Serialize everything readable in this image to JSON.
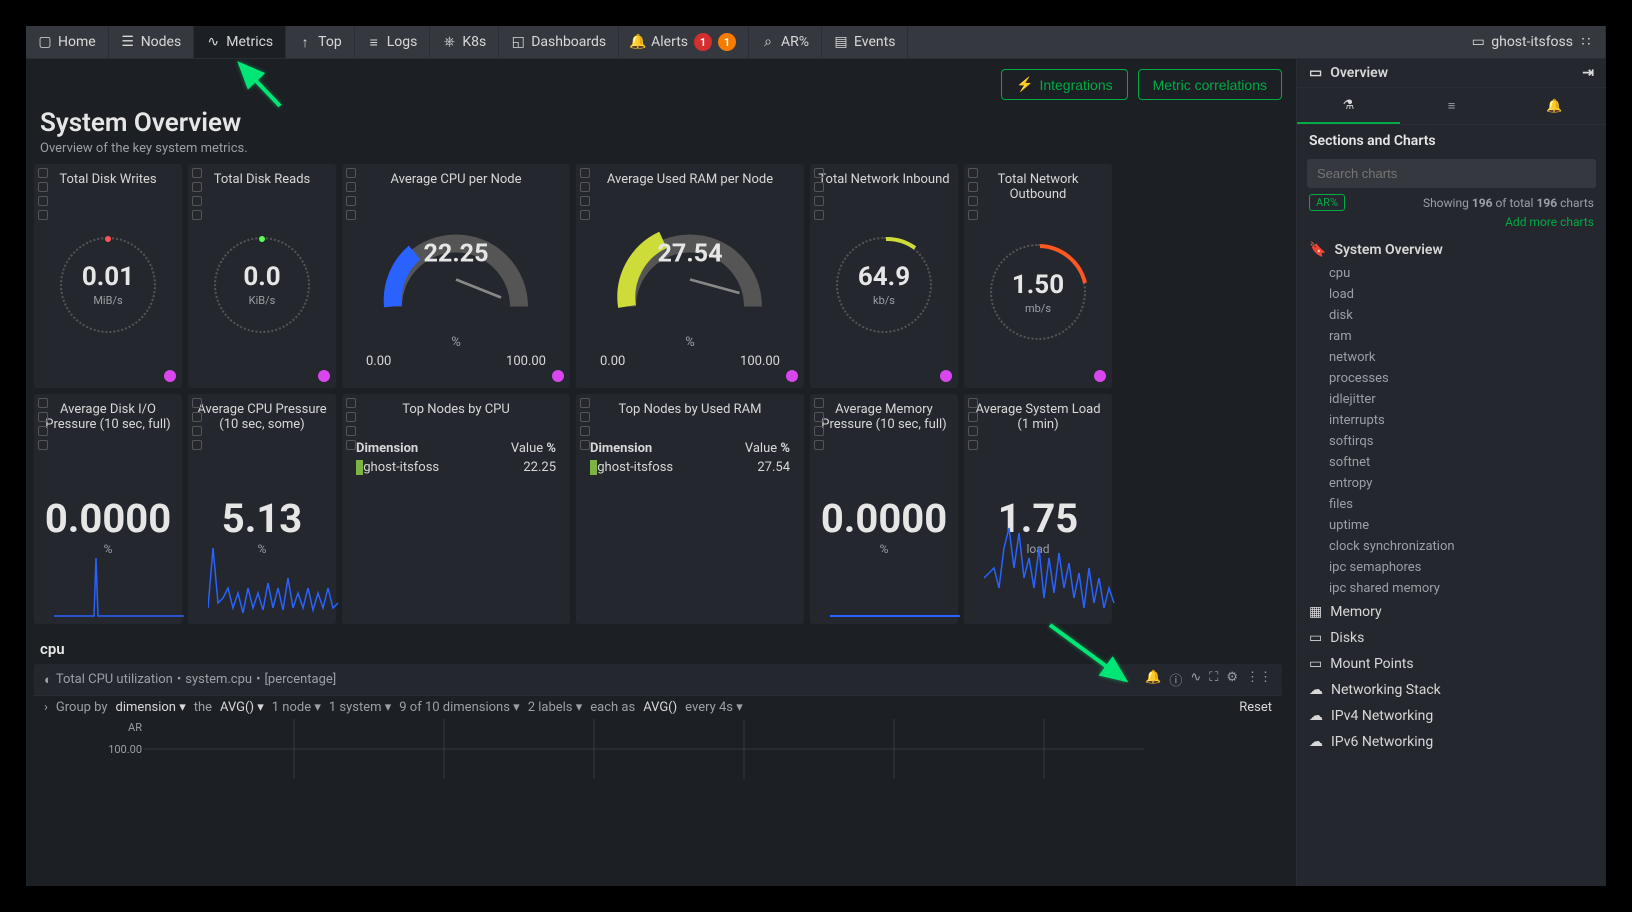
{
  "tabs": {
    "home": "Home",
    "nodes": "Nodes",
    "metrics": "Metrics",
    "top": "Top",
    "logs": "Logs",
    "k8s": "K8s",
    "dashboards": "Dashboards",
    "alerts": "Alerts",
    "alerts_badge_red": "1",
    "alerts_badge_orange": "1",
    "ar": "AR%",
    "events": "Events",
    "node_name": "ghost-itsfoss"
  },
  "actions": {
    "integrations": "Integrations",
    "correlations": "Metric correlations"
  },
  "page": {
    "title": "System Overview",
    "subtitle": "Overview of the key system metrics."
  },
  "cards": {
    "disk_writes": {
      "title": "Total Disk Writes",
      "value": "0.01",
      "unit": "MiB/s"
    },
    "disk_reads": {
      "title": "Total Disk Reads",
      "value": "0.0",
      "unit": "KiB/s"
    },
    "cpu_gauge": {
      "title": "Average CPU per Node",
      "value": "22.25",
      "unit": "%",
      "min": "0.00",
      "max": "100.00"
    },
    "ram_gauge": {
      "title": "Average Used RAM per Node",
      "value": "27.54",
      "unit": "%",
      "min": "0.00",
      "max": "100.00"
    },
    "net_in": {
      "title": "Total Network Inbound",
      "value": "64.9",
      "unit": "kb/s"
    },
    "net_out": {
      "title": "Total Network Outbound",
      "value": "1.50",
      "unit": "mb/s"
    },
    "disk_io_pressure": {
      "title": "Average Disk I/O Pressure (10 sec, full)",
      "value": "0.0000",
      "unit": "%"
    },
    "cpu_pressure": {
      "title": "Average CPU Pressure (10 sec, some)",
      "value": "5.13",
      "unit": "%"
    },
    "top_cpu": {
      "title": "Top Nodes by CPU",
      "dim_h": "Dimension",
      "val_h": "Value %",
      "row_name": "ghost-itsfoss",
      "row_val": "22.25"
    },
    "top_ram": {
      "title": "Top Nodes by Used RAM",
      "dim_h": "Dimension",
      "val_h": "Value %",
      "row_name": "ghost-itsfoss",
      "row_val": "27.54"
    },
    "mem_pressure": {
      "title": "Average Memory Pressure (10 sec, full)",
      "value": "0.0000",
      "unit": "%"
    },
    "sys_load": {
      "title": "Average System Load (1 min)",
      "value": "1.75",
      "unit": "load"
    }
  },
  "cpu_section": {
    "heading": "cpu",
    "crumb1": "Total CPU utilization",
    "crumb2": "system.cpu",
    "crumb3": "[percentage]",
    "groupby": "Group by",
    "dimension": "dimension",
    "the": "the",
    "avg": "AVG()",
    "node": "1 node",
    "system": "1 system",
    "dims": "9 of 10 dimensions",
    "labels": "2 labels",
    "eachas": "each as",
    "every": "every 4s",
    "reset": "Reset",
    "ylab1": "AR",
    "ylab2": "100.00"
  },
  "sidebar": {
    "overview": "Overview",
    "sections_title": "Sections and Charts",
    "search_placeholder": "Search charts",
    "pill": "AR%",
    "showing_pre": "Showing",
    "showing_n1": "196",
    "showing_mid": "of total",
    "showing_n2": "196",
    "showing_suf": "charts",
    "add_more": "Add more charts",
    "group_system": "System Overview",
    "items": [
      "cpu",
      "load",
      "disk",
      "ram",
      "network",
      "processes",
      "idlejitter",
      "interrupts",
      "softirqs",
      "softnet",
      "entropy",
      "files",
      "uptime",
      "clock synchronization",
      "ipc semaphores",
      "ipc shared memory"
    ],
    "group_memory": "Memory",
    "group_disks": "Disks",
    "group_mount": "Mount Points",
    "group_netstack": "Networking Stack",
    "group_ipv4": "IPv4 Networking",
    "group_ipv6": "IPv6 Networking"
  },
  "chart_data": [
    {
      "type": "gauge",
      "title": "Total Disk Writes",
      "value": 0.01,
      "unit": "MiB/s"
    },
    {
      "type": "gauge",
      "title": "Total Disk Reads",
      "value": 0.0,
      "unit": "KiB/s"
    },
    {
      "type": "gauge",
      "title": "Average CPU per Node",
      "value": 22.25,
      "min": 0,
      "max": 100,
      "unit": "%"
    },
    {
      "type": "gauge",
      "title": "Average Used RAM per Node",
      "value": 27.54,
      "min": 0,
      "max": 100,
      "unit": "%"
    },
    {
      "type": "gauge",
      "title": "Total Network Inbound",
      "value": 64.9,
      "unit": "kb/s"
    },
    {
      "type": "gauge",
      "title": "Total Network Outbound",
      "value": 1.5,
      "unit": "mb/s"
    },
    {
      "type": "line",
      "title": "Average Disk I/O Pressure (10 sec, full)",
      "latest": 0.0,
      "unit": "%"
    },
    {
      "type": "line",
      "title": "Average CPU Pressure (10 sec, some)",
      "latest": 5.13,
      "unit": "%"
    },
    {
      "type": "table",
      "title": "Top Nodes by CPU",
      "columns": [
        "Dimension",
        "Value %"
      ],
      "rows": [
        [
          "ghost-itsfoss",
          22.25
        ]
      ]
    },
    {
      "type": "table",
      "title": "Top Nodes by Used RAM",
      "columns": [
        "Dimension",
        "Value %"
      ],
      "rows": [
        [
          "ghost-itsfoss",
          27.54
        ]
      ]
    },
    {
      "type": "line",
      "title": "Average Memory Pressure (10 sec, full)",
      "latest": 0.0,
      "unit": "%"
    },
    {
      "type": "line",
      "title": "Average System Load (1 min)",
      "latest": 1.75,
      "unit": "load"
    }
  ]
}
